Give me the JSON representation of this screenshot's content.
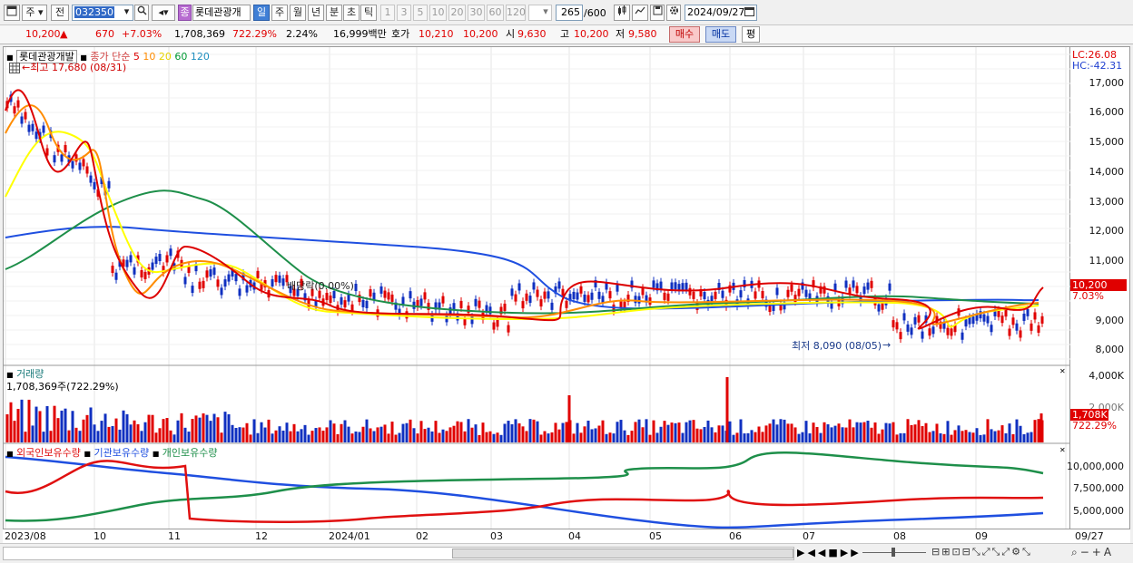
{
  "toolbar": {
    "market": "주",
    "prev": "전",
    "code": "032350",
    "name_badge": "종",
    "name": "롯데관광개",
    "periods": [
      "일",
      "주",
      "월",
      "년",
      "분",
      "초",
      "틱"
    ],
    "active_period": "일",
    "minutes": [
      "1",
      "3",
      "5",
      "10",
      "20",
      "30",
      "60",
      "120"
    ],
    "count": "265",
    "count_max": "/600",
    "date": "2024/09/27"
  },
  "quote": {
    "price": "10,200",
    "change": "670",
    "change_pct": "+7.03%",
    "volume": "1,708,369",
    "volume_pct": "722.29%",
    "turnover": "2.24%",
    "amount": "16,999백만",
    "bid_label": "호가",
    "bid1": "10,210",
    "bid2": "10,200",
    "open_label": "시",
    "open": "9,630",
    "high_label": "고",
    "high": "10,200",
    "low_label": "저",
    "low": "9,580",
    "buy": "매수",
    "sell": "매도",
    "eval": "평"
  },
  "price_pane": {
    "title": "롯데관광개발",
    "ma_label": "종가 단순",
    "ma_periods": [
      "5",
      "10",
      "20",
      "60",
      "120"
    ],
    "ma_colors": [
      "#dd0000",
      "#ff8c00",
      "#ffff00",
      "#009933",
      "#1f4fe0"
    ],
    "high_note": "←최고 17,680 (08/31)",
    "low_note": "최저 8,090 (08/05)",
    "dividend_note": "배당락(0.00%)",
    "lc": "LC:26.08",
    "hc": "HC:-42.31",
    "last_tag": "10,200",
    "last_pct": "7.03%",
    "yticks": [
      "17,000",
      "16,000",
      "15,000",
      "14,000",
      "13,000",
      "12,000",
      "11,000",
      "10,000",
      "9,000",
      "8,000"
    ]
  },
  "volume_pane": {
    "title": "거래량",
    "info": "1,708,369주(722.29%)",
    "yticks": [
      "4,000K",
      "2,000K"
    ],
    "last_tag": "1,708K",
    "last_pct": "722.29%"
  },
  "holding_pane": {
    "legends": [
      "외국인보유수량",
      "기관보유수량",
      "개인보유수량"
    ],
    "colors": [
      "#e01010",
      "#1f4fe0",
      "#1e8f4a"
    ],
    "yticks": [
      "10,000,000",
      "7,500,000",
      "5,000,000"
    ]
  },
  "xaxis": [
    "2023/08",
    "10",
    "11",
    "12",
    "2024/01",
    "02",
    "03",
    "04",
    "05",
    "06",
    "07",
    "08",
    "09",
    "09/27"
  ]
}
